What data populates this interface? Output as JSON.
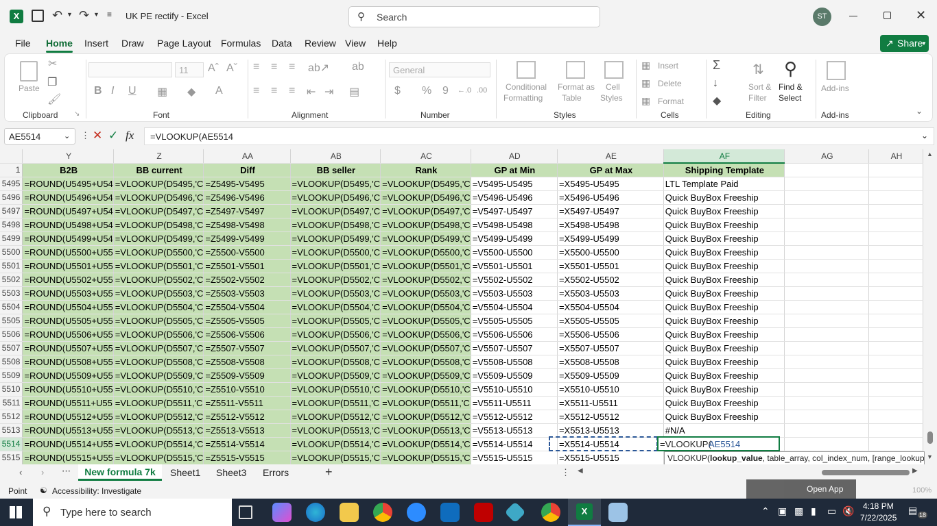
{
  "titlebar": {
    "doc_title": "UK PE rectify  -  Excel",
    "search_placeholder": "Search",
    "avatar_initials": "ST"
  },
  "menu": [
    "File",
    "Home",
    "Insert",
    "Draw",
    "Page Layout",
    "Formulas",
    "Data",
    "Review",
    "View",
    "Help"
  ],
  "share_label": "Share",
  "ribbon": {
    "clipboard": {
      "paste": "Paste",
      "group": "Clipboard"
    },
    "font": {
      "font_size": "11",
      "group": "Font"
    },
    "alignment": {
      "group": "Alignment"
    },
    "number": {
      "format": "General",
      "group": "Number"
    },
    "styles": {
      "conditional": "Conditional",
      "formatting": "Formatting",
      "format_as": "Format as",
      "table": "Table",
      "cell": "Cell",
      "styles_lbl": "Styles",
      "group": "Styles"
    },
    "cells": {
      "insert": "Insert",
      "delete": "Delete",
      "format": "Format",
      "group": "Cells"
    },
    "editing": {
      "sort": "Sort &",
      "filter": "Filter",
      "find": "Find &",
      "select": "Select",
      "group": "Editing"
    },
    "addins": {
      "label": "Add-ins",
      "group": "Add-ins"
    }
  },
  "formula_bar": {
    "name_box": "AE5514",
    "formula": "=VLOOKUP(AE5514"
  },
  "columns": [
    "Y",
    "Z",
    "AA",
    "AB",
    "AC",
    "AD",
    "AE",
    "AF",
    "AG",
    "AH"
  ],
  "header_row": {
    "num": "1",
    "cells": [
      "B2B",
      "BB current",
      "Diff",
      "BB seller",
      "Rank",
      "GP at Min",
      "GP at Max",
      "Shipping Template"
    ]
  },
  "rows": [
    {
      "num": "5495",
      "cells": [
        "=ROUND(U5495+U54",
        "=VLOOKUP(D5495,'C",
        "=Z5495-V5495",
        "=VLOOKUP(D5495,'C",
        "=VLOOKUP(D5495,'C",
        "=V5495-U5495",
        "=X5495-U5495",
        "LTL Template Paid"
      ]
    },
    {
      "num": "5496",
      "cells": [
        "=ROUND(U5496+U54",
        "=VLOOKUP(D5496,'C",
        "=Z5496-V5496",
        "=VLOOKUP(D5496,'C",
        "=VLOOKUP(D5496,'C",
        "=V5496-U5496",
        "=X5496-U5496",
        "Quick BuyBox Freeship"
      ]
    },
    {
      "num": "5497",
      "cells": [
        "=ROUND(U5497+U54",
        "=VLOOKUP(D5497,'C",
        "=Z5497-V5497",
        "=VLOOKUP(D5497,'C",
        "=VLOOKUP(D5497,'C",
        "=V5497-U5497",
        "=X5497-U5497",
        "Quick BuyBox Freeship"
      ]
    },
    {
      "num": "5498",
      "cells": [
        "=ROUND(U5498+U54",
        "=VLOOKUP(D5498,'C",
        "=Z5498-V5498",
        "=VLOOKUP(D5498,'C",
        "=VLOOKUP(D5498,'C",
        "=V5498-U5498",
        "=X5498-U5498",
        "Quick BuyBox Freeship"
      ]
    },
    {
      "num": "5499",
      "cells": [
        "=ROUND(U5499+U54",
        "=VLOOKUP(D5499,'C",
        "=Z5499-V5499",
        "=VLOOKUP(D5499,'C",
        "=VLOOKUP(D5499,'C",
        "=V5499-U5499",
        "=X5499-U5499",
        "Quick BuyBox Freeship"
      ]
    },
    {
      "num": "5500",
      "cells": [
        "=ROUND(U5500+U55",
        "=VLOOKUP(D5500,'C",
        "=Z5500-V5500",
        "=VLOOKUP(D5500,'C",
        "=VLOOKUP(D5500,'C",
        "=V5500-U5500",
        "=X5500-U5500",
        "Quick BuyBox Freeship"
      ]
    },
    {
      "num": "5501",
      "cells": [
        "=ROUND(U5501+U55",
        "=VLOOKUP(D5501,'C",
        "=Z5501-V5501",
        "=VLOOKUP(D5501,'C",
        "=VLOOKUP(D5501,'C",
        "=V5501-U5501",
        "=X5501-U5501",
        "Quick BuyBox Freeship"
      ]
    },
    {
      "num": "5502",
      "cells": [
        "=ROUND(U5502+U55",
        "=VLOOKUP(D5502,'C",
        "=Z5502-V5502",
        "=VLOOKUP(D5502,'C",
        "=VLOOKUP(D5502,'C",
        "=V5502-U5502",
        "=X5502-U5502",
        "Quick BuyBox Freeship"
      ]
    },
    {
      "num": "5503",
      "cells": [
        "=ROUND(U5503+U55",
        "=VLOOKUP(D5503,'C",
        "=Z5503-V5503",
        "=VLOOKUP(D5503,'C",
        "=VLOOKUP(D5503,'C",
        "=V5503-U5503",
        "=X5503-U5503",
        "Quick BuyBox Freeship"
      ]
    },
    {
      "num": "5504",
      "cells": [
        "=ROUND(U5504+U55",
        "=VLOOKUP(D5504,'C",
        "=Z5504-V5504",
        "=VLOOKUP(D5504,'C",
        "=VLOOKUP(D5504,'C",
        "=V5504-U5504",
        "=X5504-U5504",
        "Quick BuyBox Freeship"
      ]
    },
    {
      "num": "5505",
      "cells": [
        "=ROUND(U5505+U55",
        "=VLOOKUP(D5505,'C",
        "=Z5505-V5505",
        "=VLOOKUP(D5505,'C",
        "=VLOOKUP(D5505,'C",
        "=V5505-U5505",
        "=X5505-U5505",
        "Quick BuyBox Freeship"
      ]
    },
    {
      "num": "5506",
      "cells": [
        "=ROUND(U5506+U55",
        "=VLOOKUP(D5506,'C",
        "=Z5506-V5506",
        "=VLOOKUP(D5506,'C",
        "=VLOOKUP(D5506,'C",
        "=V5506-U5506",
        "=X5506-U5506",
        "Quick BuyBox Freeship"
      ]
    },
    {
      "num": "5507",
      "cells": [
        "=ROUND(U5507+U55",
        "=VLOOKUP(D5507,'C",
        "=Z5507-V5507",
        "=VLOOKUP(D5507,'C",
        "=VLOOKUP(D5507,'C",
        "=V5507-U5507",
        "=X5507-U5507",
        "Quick BuyBox Freeship"
      ]
    },
    {
      "num": "5508",
      "cells": [
        "=ROUND(U5508+U55",
        "=VLOOKUP(D5508,'C",
        "=Z5508-V5508",
        "=VLOOKUP(D5508,'C",
        "=VLOOKUP(D5508,'C",
        "=V5508-U5508",
        "=X5508-U5508",
        "Quick BuyBox Freeship"
      ]
    },
    {
      "num": "5509",
      "cells": [
        "=ROUND(U5509+U55",
        "=VLOOKUP(D5509,'C",
        "=Z5509-V5509",
        "=VLOOKUP(D5509,'C",
        "=VLOOKUP(D5509,'C",
        "=V5509-U5509",
        "=X5509-U5509",
        "Quick BuyBox Freeship"
      ]
    },
    {
      "num": "5510",
      "cells": [
        "=ROUND(U5510+U55",
        "=VLOOKUP(D5510,'C",
        "=Z5510-V5510",
        "=VLOOKUP(D5510,'C",
        "=VLOOKUP(D5510,'C",
        "=V5510-U5510",
        "=X5510-U5510",
        "Quick BuyBox Freeship"
      ]
    },
    {
      "num": "5511",
      "cells": [
        "=ROUND(U5511+U55",
        "=VLOOKUP(D5511,'C",
        "=Z5511-V5511",
        "=VLOOKUP(D5511,'C",
        "=VLOOKUP(D5511,'C",
        "=V5511-U5511",
        "=X5511-U5511",
        "Quick BuyBox Freeship"
      ]
    },
    {
      "num": "5512",
      "cells": [
        "=ROUND(U5512+U55",
        "=VLOOKUP(D5512,'C",
        "=Z5512-V5512",
        "=VLOOKUP(D5512,'C",
        "=VLOOKUP(D5512,'C",
        "=V5512-U5512",
        "=X5512-U5512",
        "Quick BuyBox Freeship"
      ]
    },
    {
      "num": "5513",
      "cells": [
        "=ROUND(U5513+U55",
        "=VLOOKUP(D5513,'C",
        "=Z5513-V5513",
        "=VLOOKUP(D5513,'C",
        "=VLOOKUP(D5513,'C",
        "=V5513-U5513",
        "=X5513-U5513",
        "#N/A"
      ]
    },
    {
      "num": "5514",
      "cells": [
        "=ROUND(U5514+U55",
        "=VLOOKUP(D5514,'C",
        "=Z5514-V5514",
        "=VLOOKUP(D5514,'C",
        "=VLOOKUP(D5514,'C",
        "=V5514-U5514",
        "=X5514-U5514",
        "=VLOOKUP("
      ]
    },
    {
      "num": "5515",
      "cells": [
        "=ROUND(U5515+U55",
        "=VLOOKUP(D5515,'C",
        "=Z5515-V5515",
        "=VLOOKUP(D5515,'C",
        "=VLOOKUP(D5515,'C",
        "=V5515-U5515",
        "=X5515-U5515",
        ""
      ]
    }
  ],
  "edit_ref": "AE5514",
  "tooltip": {
    "fn": "VLOOKUP(",
    "arg1": "lookup_value",
    "rest": ", table_array, col_index_num, [range_lookup])"
  },
  "sheets": [
    "New formula 7k",
    "Sheet1",
    "Sheet3",
    "Errors"
  ],
  "active_sheet": "New formula 7k",
  "status": {
    "mode": "Point",
    "accessibility": "Accessibility: Investigate",
    "open_app": "Open App",
    "zoom": "100%"
  },
  "taskbar": {
    "search_placeholder": "Type here to search",
    "time": "4:18 PM",
    "date": "7/22/2025",
    "notifications": "18"
  },
  "colors": {
    "excel_green": "#107c41",
    "cell_green": "#c5e0b4",
    "taskbar": "#1f2a3a"
  }
}
